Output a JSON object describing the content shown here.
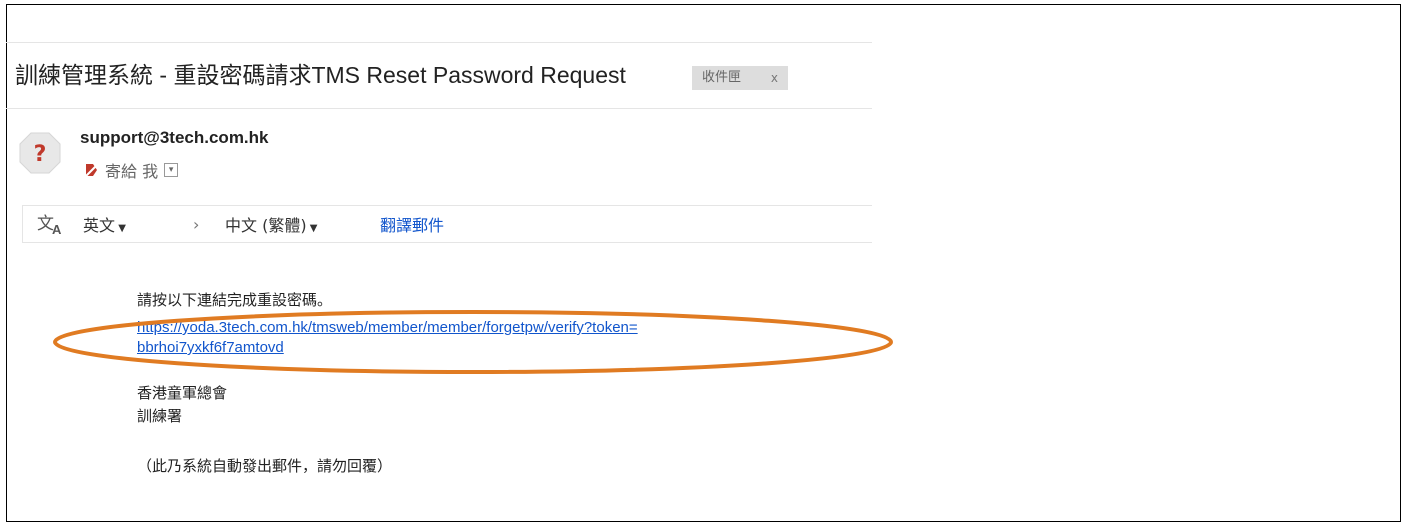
{
  "email": {
    "subject": "訓練管理系統 - 重設密碼請求TMS Reset Password Request",
    "label": "收件匣",
    "label_close": "x",
    "sender": "support@3tech.com.hk",
    "to": "寄給 我",
    "translate": {
      "source_lang": "英文",
      "arrow": "›",
      "target_lang": "中文 (繁體)",
      "action": "翻譯郵件"
    },
    "body": {
      "instruction": "請按以下連結完成重設密碼。",
      "link_line1": "https://yoda.3tech.com.hk/tmsweb/member/member/forgetpw/verify?token=",
      "link_line2": "bbrhoi7yxkf6f7amtovd",
      "org_name": "香港童軍總會",
      "dept": "訓練署",
      "notice": "（此乃系統自動發出郵件，請勿回覆）"
    }
  },
  "colors": {
    "link": "#1155cc",
    "annotation": "#e07b22",
    "important_marker": "#c0392b"
  },
  "icons": {
    "avatar": "question-avatar-icon",
    "important": "important-marker-icon",
    "translate": "translate-icon"
  }
}
